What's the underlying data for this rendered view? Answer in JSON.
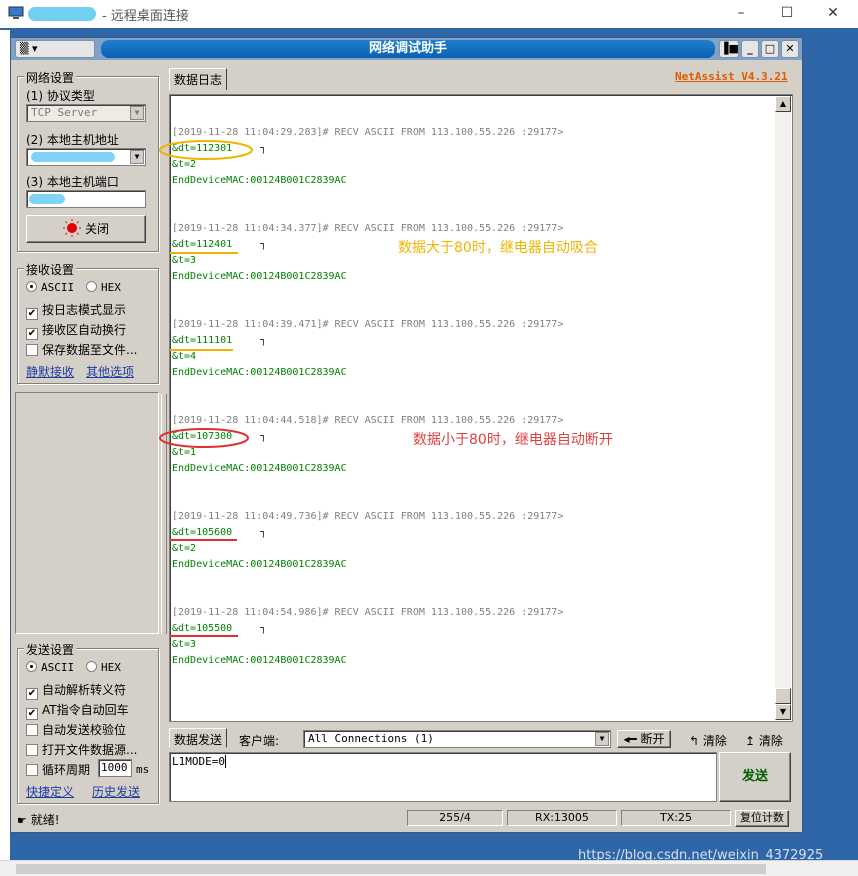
{
  "remote": {
    "title": "- 远程桌面连接",
    "min": "–",
    "max": "☐",
    "close": "✕"
  },
  "app": {
    "title": "网络调试助手",
    "sysmenu": "▒ ▾",
    "ctl_pin": "▐■",
    "ctl_min": "_",
    "ctl_max": "□",
    "ctl_close": "✕",
    "version": "NetAssist V4.3.21"
  },
  "network": {
    "legend": "网络设置",
    "proto_label": "(1) 协议类型",
    "proto_value": "TCP Server",
    "host_label": "(2) 本地主机地址",
    "port_label": "(3) 本地主机端口",
    "close_btn": "关闭"
  },
  "receive": {
    "legend": "接收设置",
    "ascii": "ASCII",
    "hex": "HEX",
    "opt_log": "按日志模式显示",
    "opt_wrap": "接收区自动换行",
    "opt_save": "保存数据至文件...",
    "link_silent": "静默接收",
    "link_other": "其他选项"
  },
  "send": {
    "legend": "发送设置",
    "ascii": "ASCII",
    "hex": "HEX",
    "opt_escape": "自动解析转义符",
    "opt_at": "AT指令自动回车",
    "opt_checksum": "自动发送校验位",
    "opt_file": "打开文件数据源...",
    "opt_loop": "循环周期",
    "loop_value": "1000",
    "loop_unit": "ms",
    "link_shortcut": "快捷定义",
    "link_history": "历史发送"
  },
  "log": {
    "tab": "数据日志",
    "entries": [
      {
        "header": "[2019-11-28 11:04:29.283]# RECV ASCII FROM 113.100.55.226 :29177>",
        "l1": "&dt=112301",
        "mark": "┐",
        "l2": "&t=2",
        "l3": "EndDeviceMAC:00124B001C2839AC"
      },
      {
        "header": "[2019-11-28 11:04:34.377]# RECV ASCII FROM 113.100.55.226 :29177>",
        "l1": "&dt=112401",
        "mark": "┐",
        "l2": "&t=3",
        "l3": "EndDeviceMAC:00124B001C2839AC"
      },
      {
        "header": "[2019-11-28 11:04:39.471]# RECV ASCII FROM 113.100.55.226 :29177>",
        "l1": "&dt=111101",
        "mark": "┐",
        "l2": "&t=4",
        "l3": "EndDeviceMAC:00124B001C2839AC"
      },
      {
        "header": "[2019-11-28 11:04:44.518]# RECV ASCII FROM 113.100.55.226 :29177>",
        "l1": "&dt=107300",
        "mark": "┐",
        "l2": "&t=1",
        "l3": "EndDeviceMAC:00124B001C2839AC"
      },
      {
        "header": "[2019-11-28 11:04:49.736]# RECV ASCII FROM 113.100.55.226 :29177>",
        "l1": "&dt=105600",
        "mark": "┐",
        "l2": "&t=2",
        "l3": "EndDeviceMAC:00124B001C2839AC"
      },
      {
        "header": "[2019-11-28 11:04:54.986]# RECV ASCII FROM 113.100.55.226 :29177>",
        "l1": "&dt=105500",
        "mark": "┐",
        "l2": "&t=3",
        "l3": "EndDeviceMAC:00124B001C2839AC"
      }
    ],
    "annot_high": "数据大于80时，继电器自动吸合",
    "annot_low": "数据小于80时，继电器自动断开"
  },
  "sendbar": {
    "tab": "数据发送",
    "client_label": "客户端:",
    "client_value": "All Connections (1)",
    "disconnect": "断开",
    "clear1": "清除",
    "clear2": "清除",
    "input_value": "L1MODE=0",
    "send_btn": "发送"
  },
  "status": {
    "ready": "就绪!",
    "count": "255/4",
    "rx": "RX:13005",
    "tx": "TX:25",
    "reset": "复位计数"
  },
  "watermark": "https://blog.csdn.net/weixin_4372925"
}
